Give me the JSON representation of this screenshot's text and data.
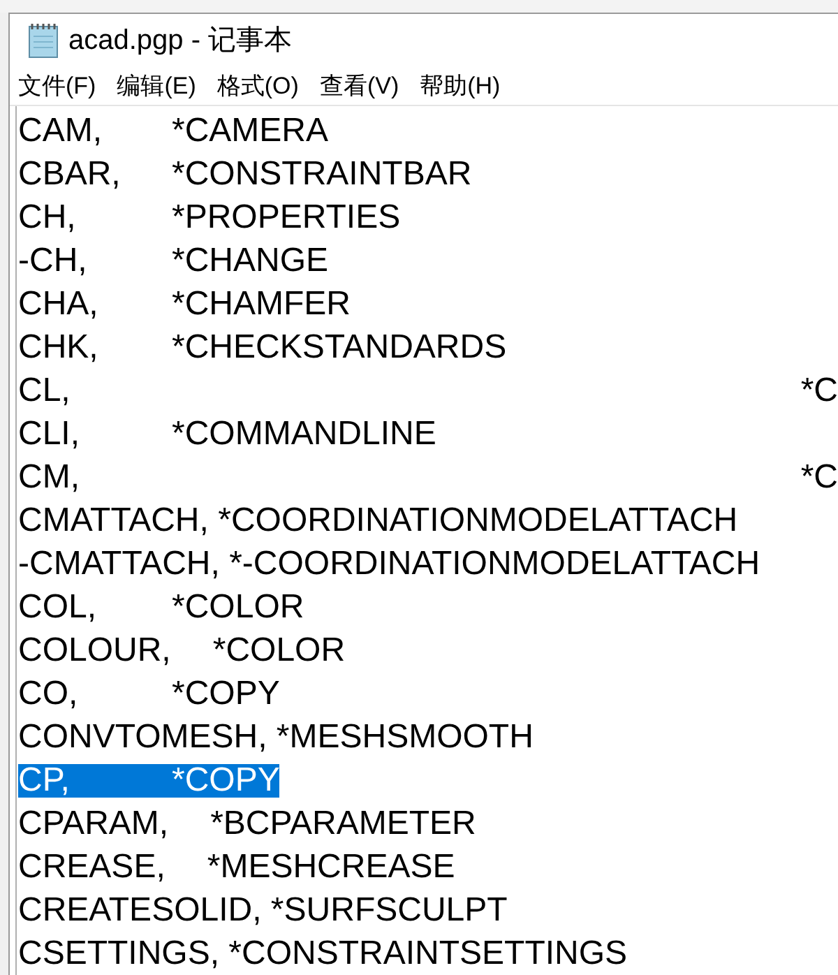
{
  "window": {
    "title": "acad.pgp - 记事本"
  },
  "menu": [
    "文件(F)",
    "编辑(E)",
    "格式(O)",
    "查看(V)",
    "帮助(H)"
  ],
  "lines": [
    {
      "kind": "near",
      "alias": "CAM,",
      "command": "*CAMERA",
      "selected": false
    },
    {
      "kind": "near",
      "alias": "CBAR,",
      "command": "*CONSTRAINTBAR",
      "selected": false
    },
    {
      "kind": "near",
      "alias": "CH,",
      "command": "*PROPERTIES",
      "selected": false
    },
    {
      "kind": "near",
      "alias": "-CH,",
      "command": "*CHANGE",
      "selected": false
    },
    {
      "kind": "near",
      "alias": "CHA,",
      "command": "*CHAMFER",
      "selected": false
    },
    {
      "kind": "near",
      "alias": "CHK,",
      "command": "*CHECKSTANDARDS",
      "selected": false
    },
    {
      "kind": "far",
      "alias": "CL,",
      "command": "*C",
      "selected": false
    },
    {
      "kind": "near",
      "alias": "CLI,",
      "command": "*COMMANDLINE",
      "selected": false
    },
    {
      "kind": "far",
      "alias": "CM,",
      "command": "*C",
      "selected": false
    },
    {
      "kind": "tight",
      "alias": "CMATTACH,",
      "command": "*COORDINATIONMODELATTACH",
      "selected": false
    },
    {
      "kind": "tight",
      "alias": "-CMATTACH,",
      "command": "*-COORDINATIONMODELATTACH",
      "selected": false
    },
    {
      "kind": "near",
      "alias": "COL,",
      "command": "*COLOR",
      "selected": false
    },
    {
      "kind": "near",
      "alias": "COLOUR,",
      "command": "*COLOR",
      "selected": false
    },
    {
      "kind": "near",
      "alias": "CO,",
      "command": "*COPY",
      "selected": false
    },
    {
      "kind": "tight",
      "alias": "CONVTOMESH,",
      "command": "*MESHSMOOTH",
      "selected": false
    },
    {
      "kind": "near",
      "alias": "CP,",
      "command": "*COPY",
      "selected": true
    },
    {
      "kind": "near",
      "alias": "CPARAM,",
      "command": "*BCPARAMETER",
      "selected": false
    },
    {
      "kind": "near",
      "alias": "CREASE,",
      "command": "*MESHCREASE",
      "selected": false
    },
    {
      "kind": "tight",
      "alias": "CREATESOLID,",
      "command": "*SURFSCULPT",
      "selected": false
    },
    {
      "kind": "tight",
      "alias": "CSETTINGS,",
      "command": "*CONSTRAINTSETTINGS",
      "selected": false
    }
  ]
}
